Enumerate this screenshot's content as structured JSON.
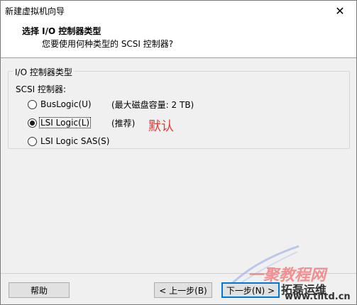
{
  "window": {
    "title": "新建虚拟机向导",
    "close_glyph": "✕"
  },
  "header": {
    "title": "选择 I/O 控制器类型",
    "subtitle": "您要使用何种类型的 SCSI 控制器?"
  },
  "group": {
    "legend": "I/O 控制器类型",
    "scsi_label": "SCSI 控制器:",
    "options": [
      {
        "label": "BusLogic(U)",
        "note": "(最大磁盘容量: 2 TB)",
        "selected": false
      },
      {
        "label": "LSI Logic(L)",
        "note": "(推荐)",
        "selected": true
      },
      {
        "label": "LSI Logic SAS(S)",
        "note": "",
        "selected": false
      }
    ]
  },
  "annotation": {
    "text": "默认",
    "color": "#e53935"
  },
  "buttons": {
    "help": "帮助",
    "back": "< 上一步(B)",
    "next": "下一步(N) >"
  },
  "watermark": {
    "site_cn": "一聚教程网",
    "brand": "拓磊运维",
    "url": "www.tlltd.cn"
  },
  "colors": {
    "focus_border": "#0078d7",
    "window_bg": "#f0f0f0"
  }
}
